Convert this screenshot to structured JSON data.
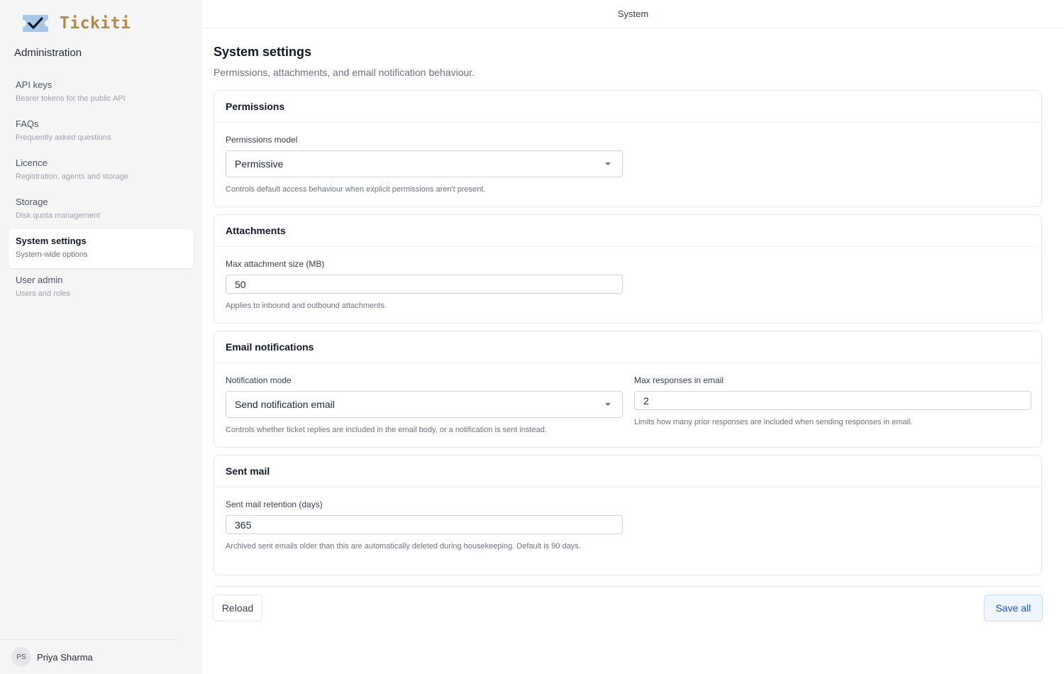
{
  "brand": {
    "name": "Tickiti",
    "logo_icon": "ticket-check-icon"
  },
  "sidebar": {
    "heading": "Administration",
    "items": [
      {
        "label": "API keys",
        "desc": "Bearer tokens for the public API",
        "active": false
      },
      {
        "label": "FAQs",
        "desc": "Frequently asked questions",
        "active": false
      },
      {
        "label": "Licence",
        "desc": "Registration, agents and storage",
        "active": false
      },
      {
        "label": "Storage",
        "desc": "Disk quota management",
        "active": false
      },
      {
        "label": "System settings",
        "desc": "System-wide options",
        "active": true
      },
      {
        "label": "User admin",
        "desc": "Users and roles",
        "active": false
      }
    ],
    "user": {
      "initials": "PS",
      "name": "Priya Sharma"
    }
  },
  "topbar": {
    "title": "System"
  },
  "page": {
    "title": "System settings",
    "subtitle": "Permissions, attachments, and email notification behaviour."
  },
  "permissions": {
    "title": "Permissions",
    "model_label": "Permissions model",
    "model_value": "Permissive",
    "model_help": "Controls default access behaviour when explicit permissions aren't present."
  },
  "attachments": {
    "title": "Attachments",
    "max_size_label": "Max attachment size (MB)",
    "max_size_value": "50",
    "max_size_help": "Applies to inbound and outbound attachments."
  },
  "email": {
    "title": "Email notifications",
    "mode_label": "Notification mode",
    "mode_value": "Send notification email",
    "mode_help": "Controls whether ticket replies are included in the email body, or a notification is sent instead.",
    "max_responses_label": "Max responses in email",
    "max_responses_value": "2",
    "max_responses_help": "Limits how many prior responses are included when sending responses in email."
  },
  "sentmail": {
    "title": "Sent mail",
    "retention_label": "Sent mail retention (days)",
    "retention_value": "365",
    "retention_help": "Archived sent emails older than this are automatically deleted during housekeeping. Default is 90 days."
  },
  "actions": {
    "reload_label": "Reload",
    "save_label": "Save all"
  },
  "colors": {
    "brand": "#b08a46",
    "accent": "#1d4ed8",
    "logo": "#a7c7e7"
  }
}
